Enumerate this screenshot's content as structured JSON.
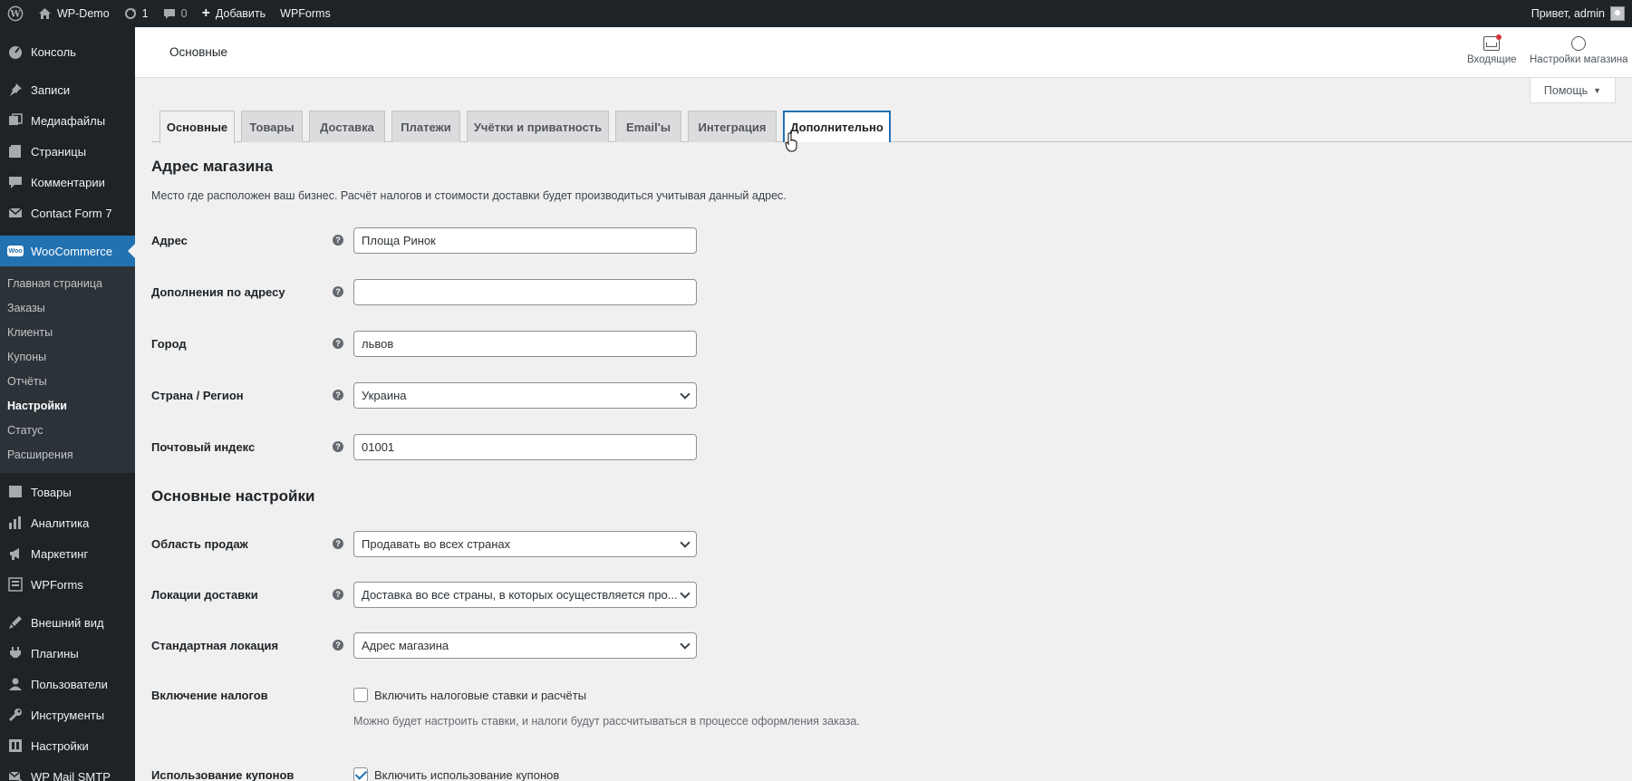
{
  "adminbar": {
    "site_name": "WP-Demo",
    "updates_count": "1",
    "comments_count": "0",
    "add_new": "Добавить",
    "wpforms": "WPForms",
    "greeting": "Привет, admin"
  },
  "sidebar": {
    "items_top": [
      {
        "label": "Консоль",
        "icon": "dashboard-icon"
      },
      {
        "label": "Записи",
        "icon": "pin-icon"
      },
      {
        "label": "Медиафайлы",
        "icon": "media-icon"
      },
      {
        "label": "Страницы",
        "icon": "pages-icon"
      },
      {
        "label": "Комментарии",
        "icon": "comments-icon"
      },
      {
        "label": "Contact Form 7",
        "icon": "mail-icon"
      }
    ],
    "woocommerce": "WooCommerce",
    "woo_badge": "Woo",
    "submenu": [
      "Главная страница",
      "Заказы",
      "Клиенты",
      "Купоны",
      "Отчёты",
      "Настройки",
      "Статус",
      "Расширения"
    ],
    "submenu_current": "Настройки",
    "items_bottom": [
      {
        "label": "Товары",
        "icon": "products-icon"
      },
      {
        "label": "Аналитика",
        "icon": "analytics-icon"
      },
      {
        "label": "Маркетинг",
        "icon": "marketing-icon"
      },
      {
        "label": "WPForms",
        "icon": "wpforms-icon"
      },
      {
        "label": "Внешний вид",
        "icon": "appearance-icon"
      },
      {
        "label": "Плагины",
        "icon": "plugins-icon"
      },
      {
        "label": "Пользователи",
        "icon": "users-icon"
      },
      {
        "label": "Инструменты",
        "icon": "tools-icon"
      },
      {
        "label": "Настройки",
        "icon": "settings-icon"
      },
      {
        "label": "WP Mail SMTP",
        "icon": "smtp-icon"
      }
    ]
  },
  "header": {
    "title": "Основные",
    "inbox": "Входящие",
    "store_setup": "Настройки магазина",
    "help": "Помощь"
  },
  "tabs": [
    "Основные",
    "Товары",
    "Доставка",
    "Платежи",
    "Учётки и приватность",
    "Email'ы",
    "Интеграция",
    "Дополнительно"
  ],
  "store_address": {
    "title": "Адрес магазина",
    "description": "Место где расположен ваш бизнес. Расчёт налогов и стоимости доставки будет производиться учитывая данный адрес.",
    "address_label": "Адрес",
    "address_value": "Площа Ринок",
    "address2_label": "Дополнения по адресу",
    "address2_value": "",
    "city_label": "Город",
    "city_value": "львов",
    "country_label": "Страна / Регион",
    "country_value": "Украина",
    "postcode_label": "Почтовый индекс",
    "postcode_value": "01001"
  },
  "general_options": {
    "title": "Основные настройки",
    "selling_label": "Область продаж",
    "selling_value": "Продавать во всех странах",
    "shipping_label": "Локации доставки",
    "shipping_value": "Доставка во все страны, в которых осуществляется про...",
    "default_location_label": "Стандартная локация",
    "default_location_value": "Адрес магазина",
    "taxes_label": "Включение налогов",
    "taxes_checkbox": "Включить налоговые ставки и расчёты",
    "taxes_desc": "Можно будет настроить ставки, и налоги будут рассчитываться в процессе оформления заказа.",
    "coupons_label": "Использование купонов",
    "coupons_checkbox": "Включить использование купонов"
  }
}
